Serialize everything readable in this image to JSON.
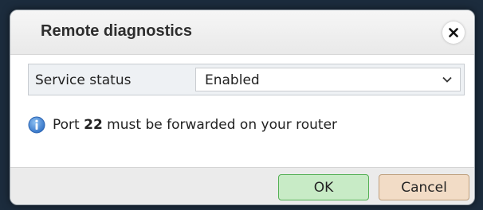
{
  "dialog": {
    "title": "Remote diagnostics",
    "close_icon": "close-icon"
  },
  "form": {
    "service_status_label": "Service status",
    "service_status_value": "Enabled",
    "dropdown_icon": "chevron-down-icon"
  },
  "info": {
    "icon": "info-icon",
    "text_before": "Port ",
    "port": "22",
    "text_after": " must be forwarded on your router"
  },
  "buttons": {
    "ok_label": "OK",
    "cancel_label": "Cancel"
  },
  "colors": {
    "ok_bg": "#c8ebc6",
    "ok_border": "#55b055",
    "cancel_bg": "#f2dcc6",
    "cancel_border": "#bfa07e",
    "info_blue": "#3f84d8"
  }
}
